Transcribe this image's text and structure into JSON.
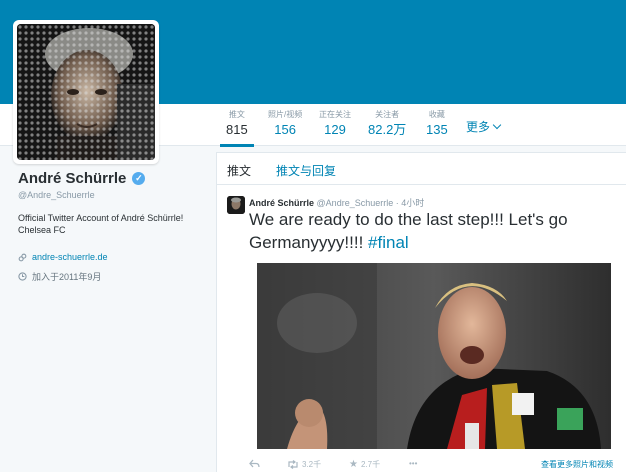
{
  "profile": {
    "name": "André Schürrle",
    "handle": "@Andre_Schuerrle",
    "bio_line1": "Official Twitter Account of André Schürrle!",
    "bio_line2": "Chelsea FC",
    "website": "andre-schuerrle.de",
    "joined": "加入于2011年9月"
  },
  "nav": {
    "stats": [
      {
        "label": "推文",
        "value": "815"
      },
      {
        "label": "照片/视频",
        "value": "156"
      },
      {
        "label": "正在关注",
        "value": "129"
      },
      {
        "label": "关注者",
        "value": "82.2万"
      },
      {
        "label": "收藏",
        "value": "135"
      }
    ],
    "more_label": "更多"
  },
  "timeline": {
    "tabs": [
      {
        "label": "推文"
      },
      {
        "label": "推文与回复"
      }
    ]
  },
  "tweet": {
    "author": "André Schürrle",
    "handle": "@Andre_Schuerrle",
    "time": "· 4小时",
    "text": "We are ready to do the last step!!! Let's go Germanyyyy!!!! ",
    "hashtag": "#final",
    "retweets": "3.2千",
    "favorites": "2.7千",
    "view_more": "查看更多照片和视频"
  },
  "colors": {
    "banner": "#0084b4",
    "link": "#0084b4",
    "verified": "#55acee"
  }
}
